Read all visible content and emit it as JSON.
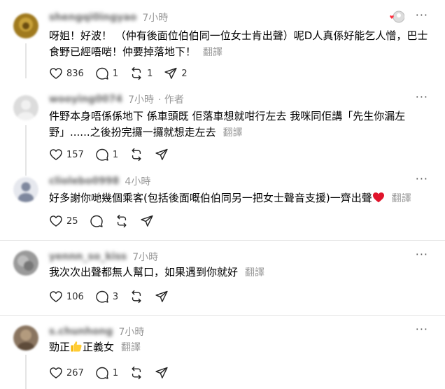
{
  "posts": [
    {
      "username": "shengqi0ingyao",
      "time": "7小時",
      "author_tag": "",
      "text": "呀姐！好波！ （仲有後面位伯伯同一位女士肯出聲）呢D人真係好能乞人憎，巴士食野已經唔啱！仲要掉落地下！",
      "translate": "翻譯",
      "likes": "836",
      "replies": "1",
      "reposts": "1",
      "shares": "2",
      "avatar_color": "#a07a1e"
    },
    {
      "username": "wooying0074",
      "time": "7小時",
      "author_tag": "· 作者",
      "text": "件野本身唔係係地下 係車頭既 佢落車想就咁行左去 我咪同佢講「先生你漏左野」......之後扮完攞一攞就想走左去",
      "translate": "翻譯",
      "likes": "157",
      "replies": "1",
      "reposts": "",
      "shares": "",
      "avatar_color": "#dcdcdc"
    },
    {
      "username": "cliolebo0998",
      "time": "4小時",
      "author_tag": "",
      "text": "好多謝你哋幾個乘客(包括後面嘅伯伯同另一把女士聲音支援)一齊出聲",
      "translate": "翻譯",
      "likes": "25",
      "replies": "",
      "reposts": "",
      "shares": "",
      "avatar_color": "#8a93a8"
    },
    {
      "username": "yennn_so_kiss",
      "time": "7小時",
      "author_tag": "",
      "text": "我次次出聲都無人幫口，如果遇到你就好",
      "translate": "翻譯",
      "likes": "106",
      "replies": "3",
      "reposts": "",
      "shares": "",
      "avatar_color": "#9a9a9a"
    },
    {
      "username": "s.chunhong",
      "time": "7小時",
      "author_tag": "",
      "text_before": "勁正",
      "text_after": "正義女",
      "translate": "翻譯",
      "likes": "267",
      "replies": "1",
      "reposts": "",
      "shares": "",
      "avatar_color": "#8a7560"
    }
  ],
  "icons": [
    "heart-icon",
    "comment-icon",
    "repost-icon",
    "share-icon",
    "more-icon",
    "like-badge-icon",
    "red-heart-emoji",
    "thumbs-up-emoji"
  ]
}
